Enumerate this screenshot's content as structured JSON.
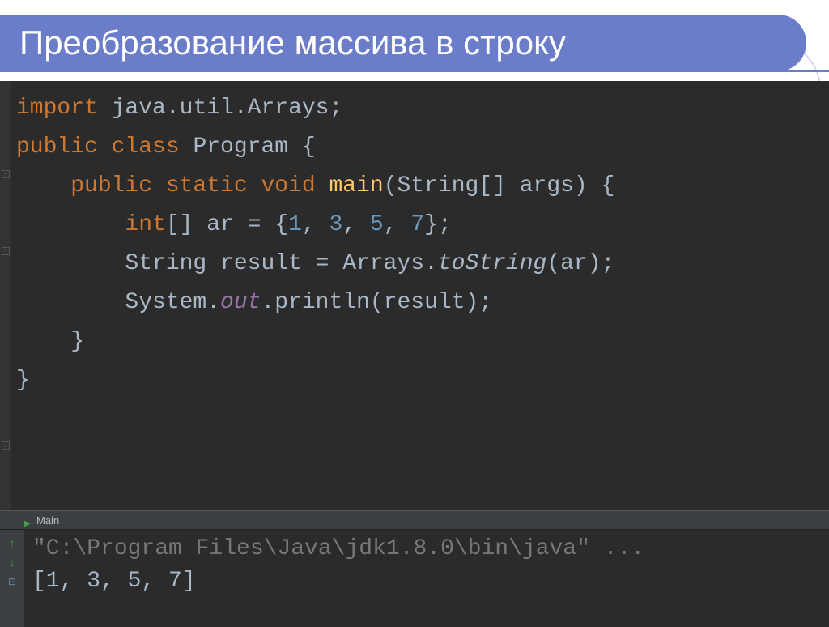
{
  "slide": {
    "title": "Преобразование массива в строку"
  },
  "code": {
    "l1a": "import",
    "l1b": " java.util.Arrays;",
    "l2": "",
    "l3a": "public class ",
    "l3b": "Program {",
    "l4": "",
    "l5a": "    public static void ",
    "l5b": "main",
    "l5c": "(String[] args) {",
    "l6a": "        int",
    "l6b": "[] ar = {",
    "l6c": "1",
    "l6d": ", ",
    "l6e": "3",
    "l6f": ", ",
    "l6g": "5",
    "l6h": ", ",
    "l6i": "7",
    "l6j": "};",
    "l7a": "        String result = Arrays.",
    "l7b": "toString",
    "l7c": "(ar);",
    "l8a": "        System.",
    "l8b": "out",
    "l8c": ".println(result);",
    "l9": "    }",
    "l10": "}"
  },
  "output": {
    "tab_label": "Main",
    "line1": "\"C:\\Program Files\\Java\\jdk1.8.0\\bin\\java\" ...",
    "line2": "[1, 3, 5, 7]"
  }
}
